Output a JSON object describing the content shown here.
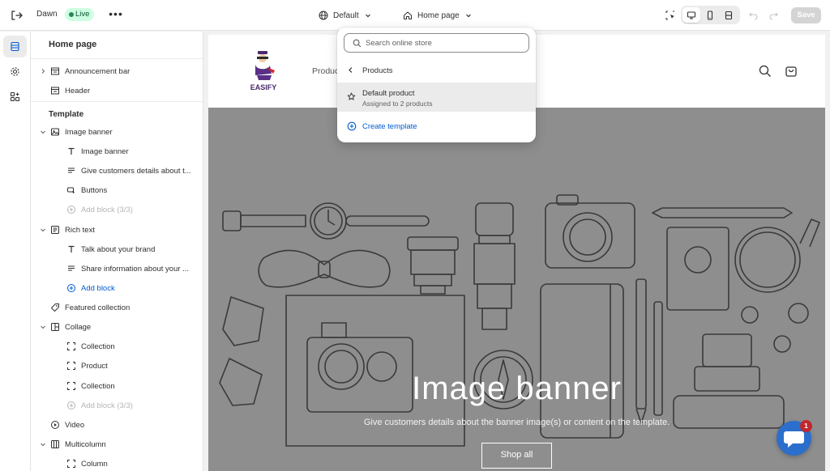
{
  "topbar": {
    "theme_name": "Dawn",
    "status": "Live",
    "more": "•••",
    "template_selector": "Default",
    "page_selector": "Home page",
    "save_label": "Save"
  },
  "sidebar": {
    "title": "Home page",
    "header_group": [
      {
        "label": "Announcement bar",
        "icon": "section-icon"
      },
      {
        "label": "Header",
        "icon": "section-icon"
      }
    ],
    "template_label": "Template",
    "sections": [
      {
        "label": "Image banner",
        "icon": "image-icon",
        "blocks": [
          {
            "label": "Image banner",
            "icon": "text-icon"
          },
          {
            "label": "Give customers details about t...",
            "icon": "paragraph-icon"
          },
          {
            "label": "Buttons",
            "icon": "button-icon"
          },
          {
            "label": "Add block (3/3)",
            "icon": "add-icon",
            "disabled": true
          }
        ]
      },
      {
        "label": "Rich text",
        "icon": "richtext-icon",
        "blocks": [
          {
            "label": "Talk about your brand",
            "icon": "text-icon"
          },
          {
            "label": "Share information about your ...",
            "icon": "paragraph-icon"
          },
          {
            "label": "Add block",
            "icon": "add-icon",
            "link": true
          }
        ]
      },
      {
        "label": "Featured collection",
        "icon": "tag-icon",
        "blocks": []
      },
      {
        "label": "Collage",
        "icon": "collage-icon",
        "blocks": [
          {
            "label": "Collection",
            "icon": "frame-icon"
          },
          {
            "label": "Product",
            "icon": "frame-icon"
          },
          {
            "label": "Collection",
            "icon": "frame-icon"
          },
          {
            "label": "Add block (3/3)",
            "icon": "add-icon",
            "disabled": true
          }
        ]
      },
      {
        "label": "Video",
        "icon": "play-icon",
        "blocks": []
      },
      {
        "label": "Multicolumn",
        "icon": "columns-icon",
        "blocks": [
          {
            "label": "Column",
            "icon": "frame-icon"
          }
        ]
      }
    ]
  },
  "store": {
    "logo_text": "EASIFY",
    "nav_link": "Produc",
    "banner_title": "Image banner",
    "banner_subtitle": "Give customers details about the banner image(s) or content on the template.",
    "banner_button": "Shop all"
  },
  "popover": {
    "search_placeholder": "Search online store",
    "back_label": "Products",
    "item_title": "Default product",
    "item_subtitle": "Assigned to 2 products",
    "create_label": "Create template"
  },
  "chat": {
    "badge": "1"
  },
  "colors": {
    "accent_blue": "#005bd3",
    "live_bg": "#cdfee1",
    "live_text": "#0c5132",
    "banner_overlay": "#8e8e8e",
    "chat_bubble": "#2c6ecb",
    "badge_red": "#c0282d"
  }
}
